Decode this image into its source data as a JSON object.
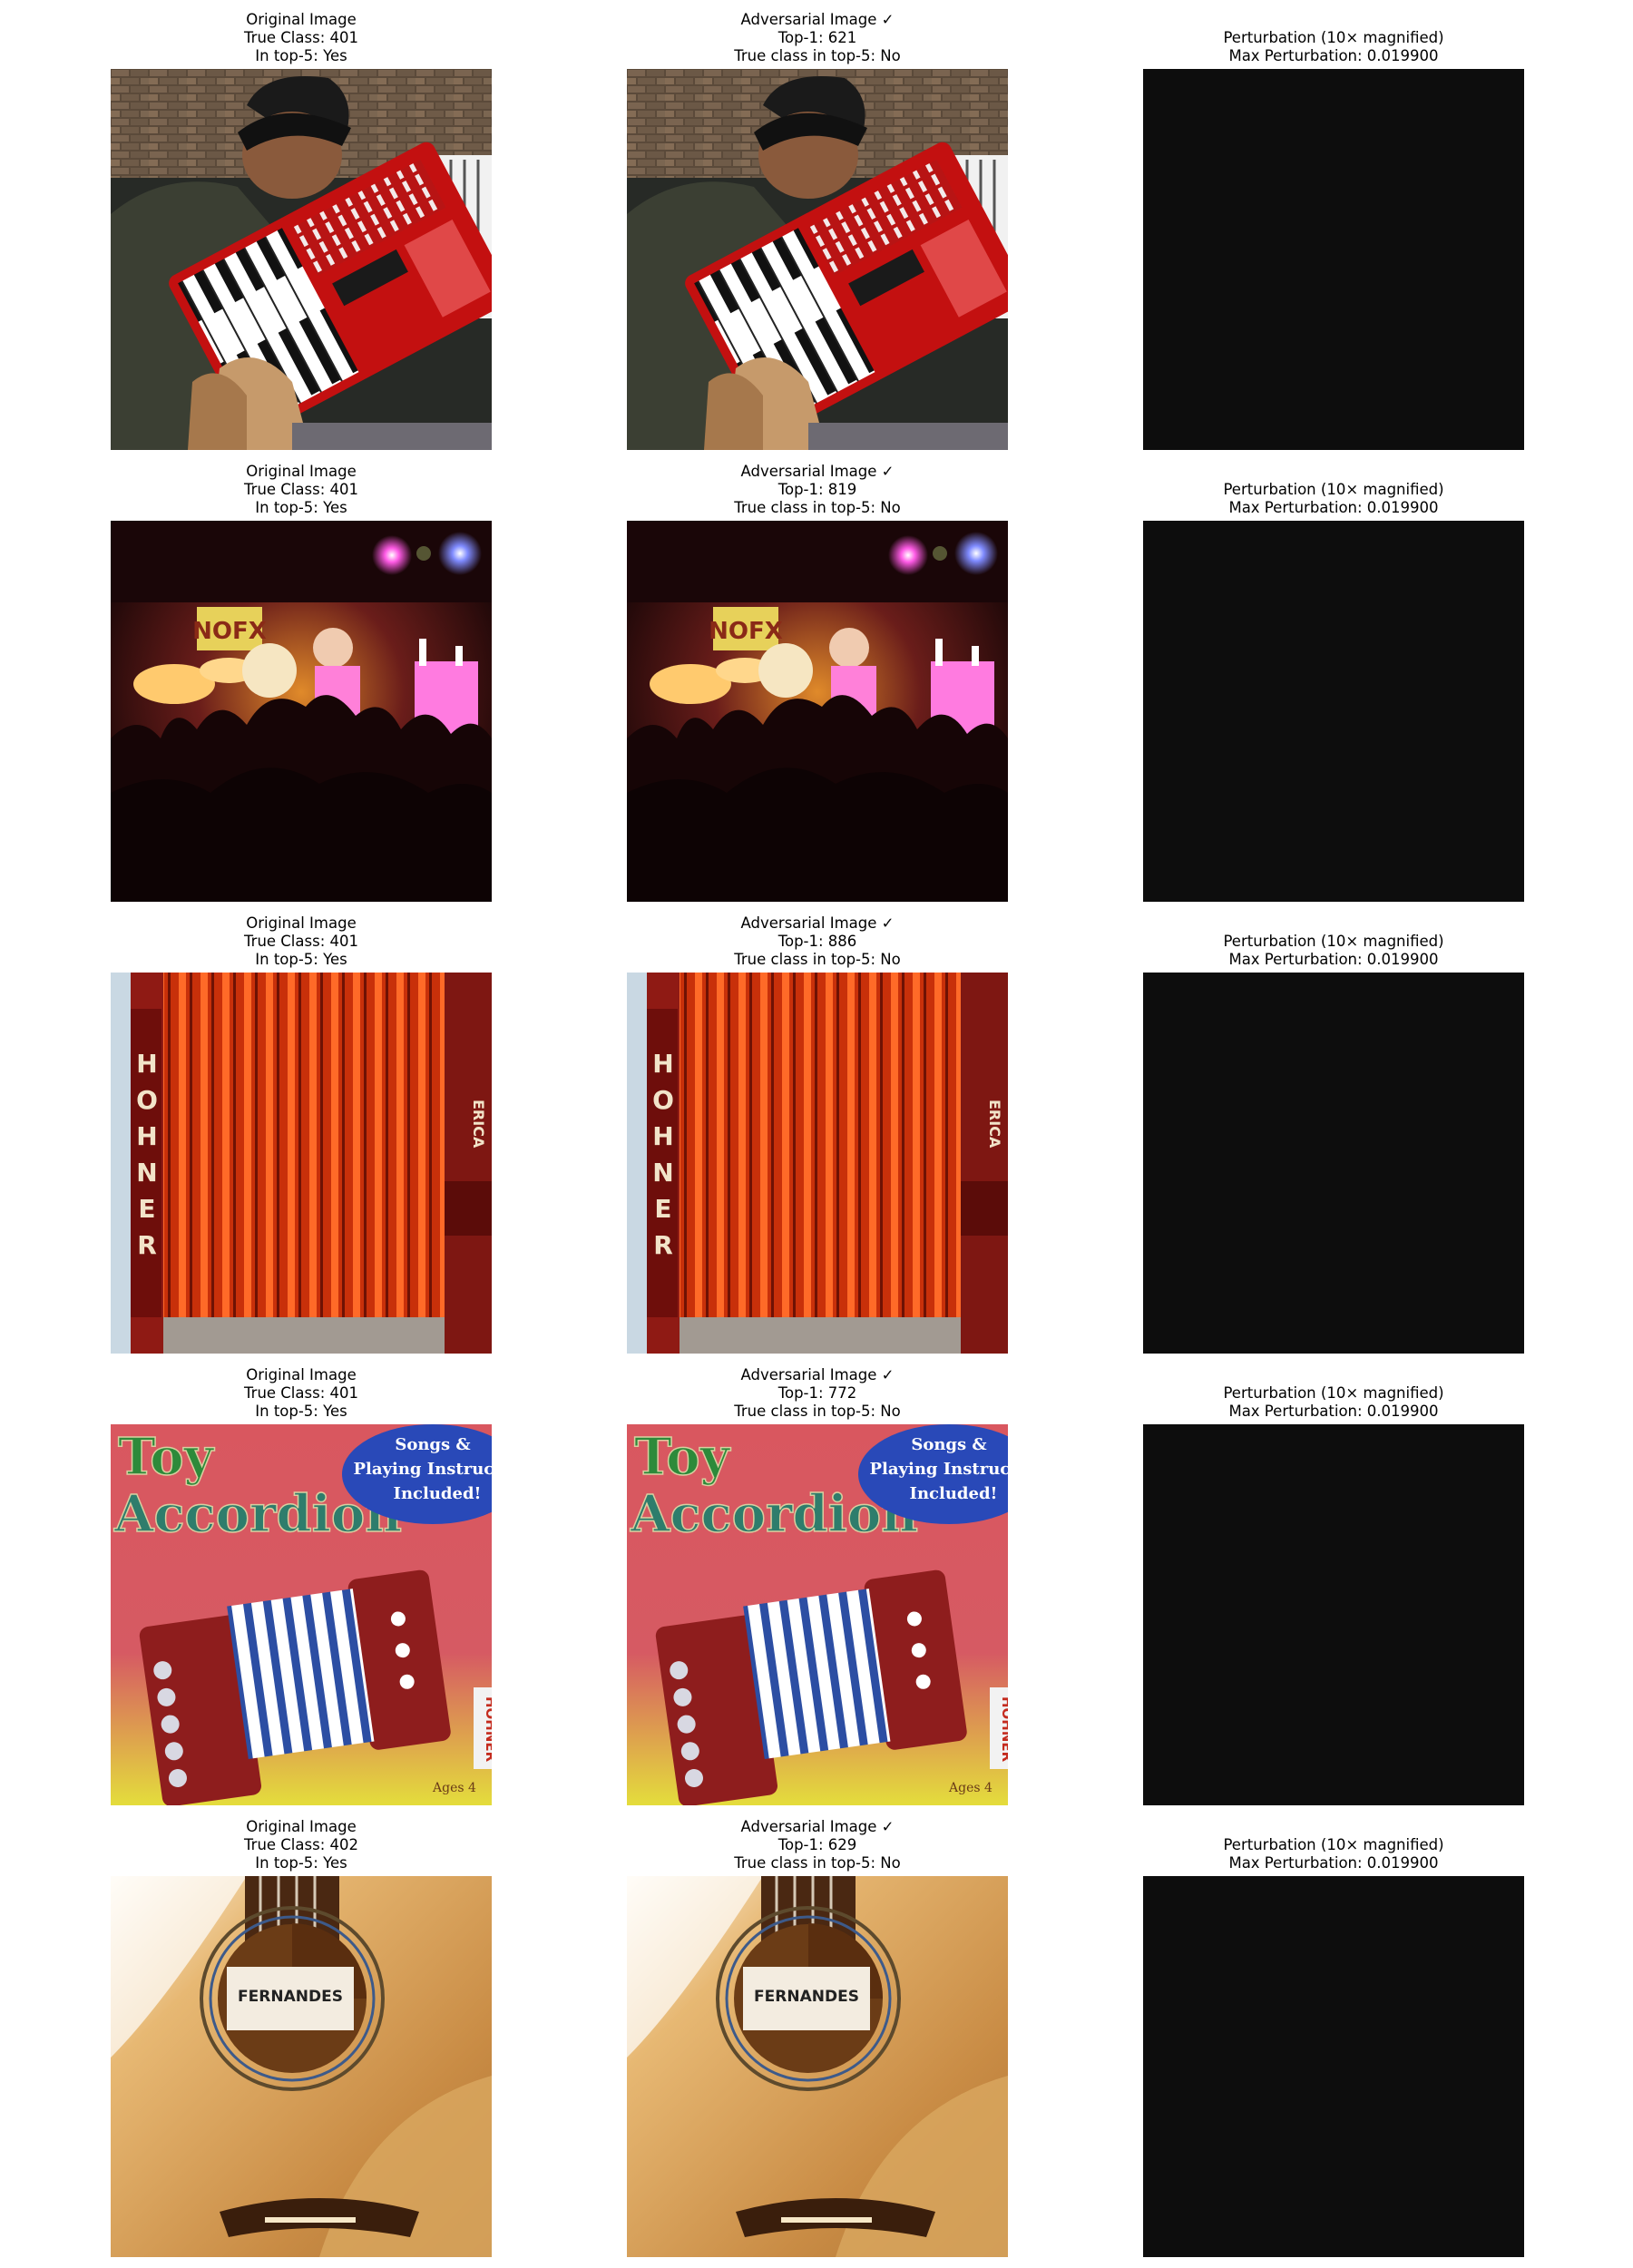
{
  "rows": [
    {
      "original": {
        "title": "Original Image",
        "label": "True Class: 401",
        "status": "In top-5: Yes"
      },
      "adversarial": {
        "title": "Adversarial Image ✓",
        "label": "Top-1: 621",
        "status": "True class in top-5: No"
      },
      "perturbation": {
        "title": "Perturbation (10× magnified)",
        "label": "Max Perturbation: 0.019900"
      }
    },
    {
      "original": {
        "title": "Original Image",
        "label": "True Class: 401",
        "status": "In top-5: Yes"
      },
      "adversarial": {
        "title": "Adversarial Image ✓",
        "label": "Top-1: 819",
        "status": "True class in top-5: No"
      },
      "perturbation": {
        "title": "Perturbation (10× magnified)",
        "label": "Max Perturbation: 0.019900"
      }
    },
    {
      "original": {
        "title": "Original Image",
        "label": "True Class: 401",
        "status": "In top-5: Yes"
      },
      "adversarial": {
        "title": "Adversarial Image ✓",
        "label": "Top-1: 886",
        "status": "True class in top-5: No"
      },
      "perturbation": {
        "title": "Perturbation (10× magnified)",
        "label": "Max Perturbation: 0.019900"
      }
    },
    {
      "original": {
        "title": "Original Image",
        "label": "True Class: 401",
        "status": "In top-5: Yes"
      },
      "adversarial": {
        "title": "Adversarial Image ✓",
        "label": "Top-1: 772",
        "status": "True class in top-5: No"
      },
      "perturbation": {
        "title": "Perturbation (10× magnified)",
        "label": "Max Perturbation: 0.019900"
      }
    },
    {
      "original": {
        "title": "Original Image",
        "label": "True Class: 402",
        "status": "In top-5: Yes"
      },
      "adversarial": {
        "title": "Adversarial Image ✓",
        "label": "Top-1: 629",
        "status": "True class in top-5: No"
      },
      "perturbation": {
        "title": "Perturbation (10× magnified)",
        "label": "Max Perturbation: 0.019900"
      }
    }
  ],
  "images": {
    "accordion_player": {
      "art_text": []
    },
    "concert": {
      "art_text": [
        "NOFX"
      ]
    },
    "bellows": {
      "art_text": [
        "HOHNER",
        "ERICA"
      ]
    },
    "toy_box": {
      "art_text": [
        "Toy",
        "Accordion",
        "Songs &",
        "Playing Instruction",
        "Included!",
        "HOHNER",
        "Ages 4"
      ]
    },
    "guitar": {
      "art_text": [
        "FERNANDES"
      ]
    }
  },
  "colors": {
    "background": "#ffffff",
    "text": "#000000",
    "perturbation": "#0d0d0d"
  }
}
